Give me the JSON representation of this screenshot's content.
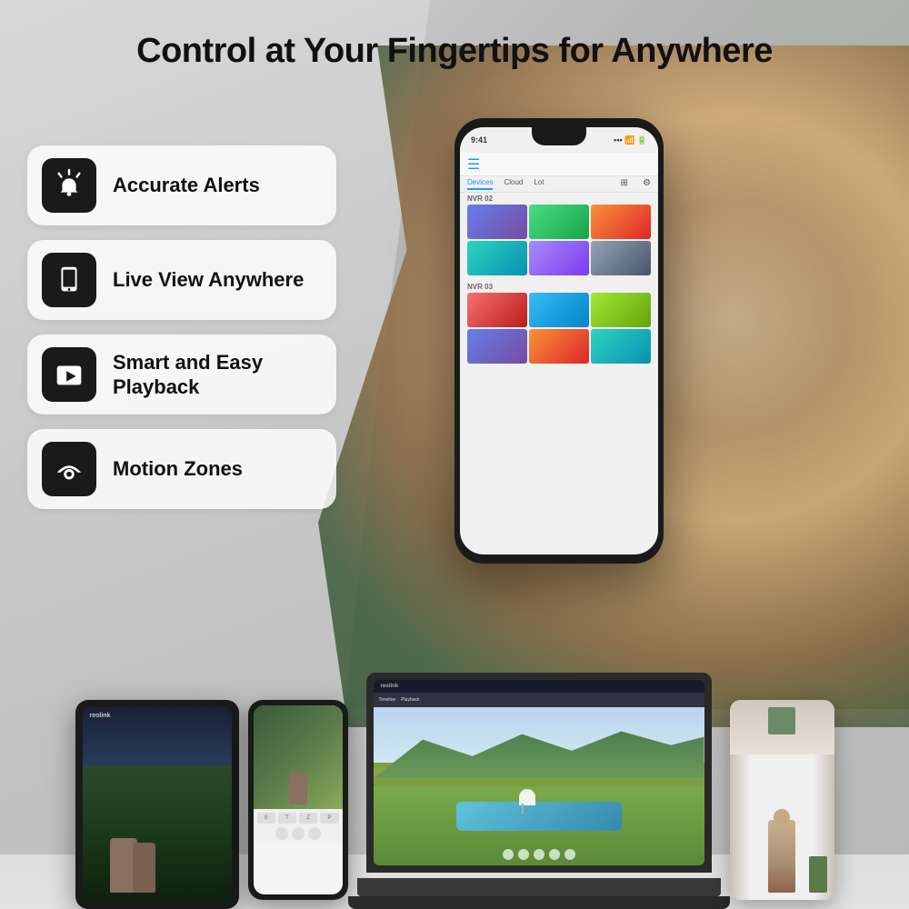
{
  "page": {
    "title": "Control at Your Fingertips for Anywhere",
    "background": "#d8d8d8"
  },
  "features": [
    {
      "id": "accurate-alerts",
      "icon": "alert-icon",
      "label": "Accurate Alerts"
    },
    {
      "id": "live-view",
      "icon": "phone-icon",
      "label": "Live View Anywhere"
    },
    {
      "id": "smart-playback",
      "icon": "play-icon",
      "label": "Smart and Easy Playback"
    },
    {
      "id": "motion-zones",
      "icon": "motion-icon",
      "label": "Motion Zones"
    }
  ],
  "phone": {
    "status_time": "9:41",
    "nav_items": [
      "Devices",
      "Cloud",
      "Lot"
    ],
    "active_nav": "Devices",
    "grid_label1": "NVR 02",
    "grid_label2": "NVR 03"
  },
  "brands": {
    "laptop": "reolink",
    "tablet": "reolink"
  },
  "devices": {
    "laptop_label": "reolink",
    "tablet_label": "reolink"
  }
}
